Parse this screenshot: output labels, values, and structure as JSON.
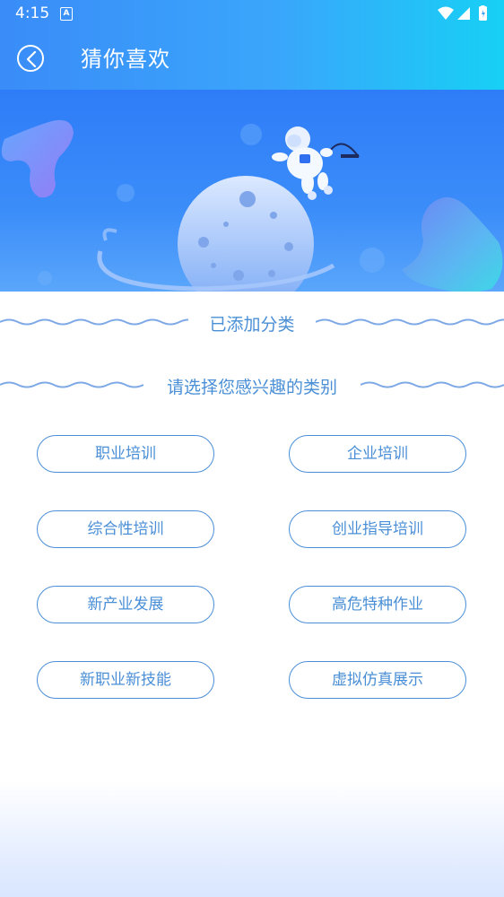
{
  "status_bar": {
    "time": "4:15",
    "notification_icon": "A",
    "icons": [
      "wifi-icon",
      "signal-icon",
      "battery-icon"
    ]
  },
  "header": {
    "title": "猜你喜欢",
    "back_icon": "chevron-left-icon"
  },
  "sections": {
    "added_title": "已添加分类",
    "select_title": "请选择您感兴趣的类别"
  },
  "categories": [
    "职业培训",
    "企业培训",
    "综合性培训",
    "创业指导培训",
    "新产业发展",
    "高危特种作业",
    "新职业新技能",
    "虚拟仿真展示"
  ],
  "colors": {
    "accent": "#4a8fd6",
    "header_start": "#3a8cf8",
    "header_end": "#17d0f5",
    "banner": "#2f7cf8"
  }
}
